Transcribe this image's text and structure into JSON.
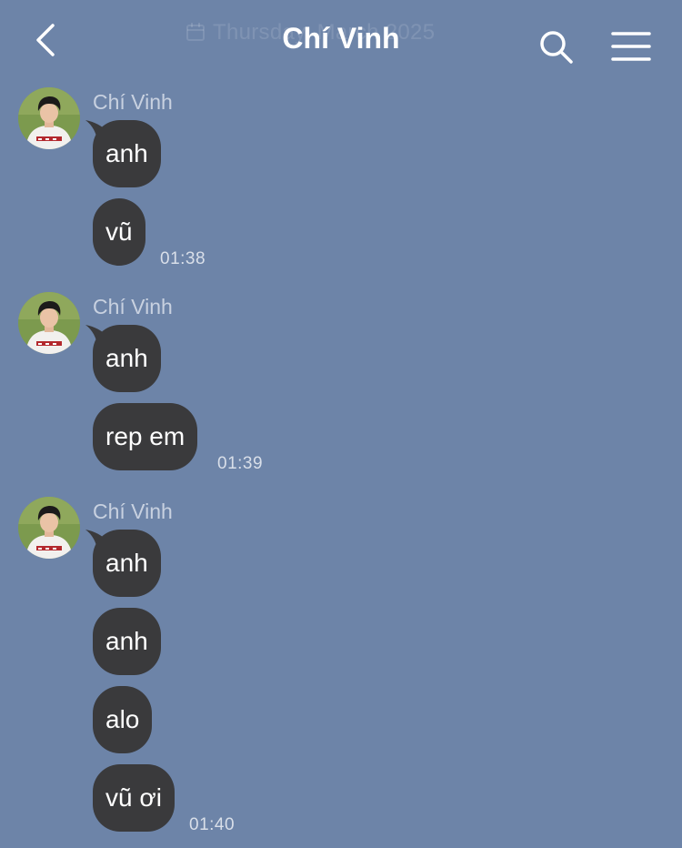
{
  "header": {
    "title": "Chí Vinh",
    "date_hint": "Thursday, March 2025",
    "back_icon": "chevron-left-icon",
    "search_icon": "search-icon",
    "menu_icon": "hamburger-menu-icon",
    "calendar_icon": "calendar-icon"
  },
  "colors": {
    "background": "#6d84a8",
    "bubble": "#3a3a3c",
    "title": "#ffffff",
    "sender": "#c8d1e0"
  },
  "message_groups": [
    {
      "sender": "Chí Vinh",
      "messages": [
        "anh",
        "vũ"
      ],
      "time": "01:38"
    },
    {
      "sender": "Chí Vinh",
      "messages": [
        "anh",
        "rep em"
      ],
      "time": "01:39"
    },
    {
      "sender": "Chí Vinh",
      "messages": [
        "anh",
        "anh",
        "alo",
        "vũ ơi"
      ],
      "time": "01:40"
    }
  ]
}
